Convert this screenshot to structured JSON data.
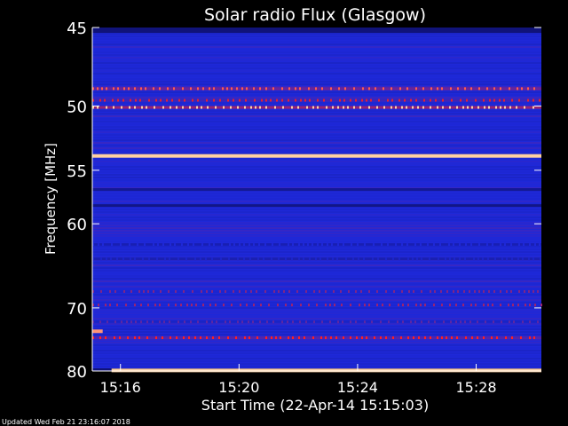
{
  "chart_data": {
    "type": "heatmap",
    "title": "Solar radio Flux (Glasgow)",
    "xlabel": "Start Time (22-Apr-14 15:15:03)",
    "ylabel": "Frequency [MHz]",
    "x_range_minutes": [
      15.05,
      30.2
    ],
    "x_ticks": [
      {
        "minute": 16,
        "label": "15:16"
      },
      {
        "minute": 20,
        "label": "15:20"
      },
      {
        "minute": 24,
        "label": "15:24"
      },
      {
        "minute": 28,
        "label": "15:28"
      }
    ],
    "y_range_mhz": [
      45,
      80
    ],
    "y_scale": "reciprocal",
    "y_ticks": [
      45,
      50,
      55,
      60,
      70,
      80
    ],
    "colormap": {
      "low": "#0a0a50",
      "mid": "#1e28d8",
      "high": "#ff2020",
      "peak": "#ffd0a0"
    },
    "bands": [
      {
        "mhz": 48.8,
        "intensity": 0.7,
        "dashed": true
      },
      {
        "mhz": 49.6,
        "intensity": 0.6,
        "dashed": true
      },
      {
        "mhz": 50.1,
        "intensity": 0.85,
        "dashed": true
      },
      {
        "mhz": 53.8,
        "intensity": 1.0,
        "dashed": false
      },
      {
        "mhz": 56.7,
        "intensity": 0.25,
        "dashed": false
      },
      {
        "mhz": 58.2,
        "intensity": 0.2,
        "dashed": false
      },
      {
        "mhz": 62.2,
        "intensity": 0.3,
        "dashed": true
      },
      {
        "mhz": 63.8,
        "intensity": 0.25,
        "dashed": true
      },
      {
        "mhz": 67.8,
        "intensity": 0.45,
        "dashed": true
      },
      {
        "mhz": 69.6,
        "intensity": 0.5,
        "dashed": true
      },
      {
        "mhz": 72.0,
        "intensity": 0.4,
        "dashed": true
      },
      {
        "mhz": 74.4,
        "intensity": 0.65,
        "dashed": true
      },
      {
        "mhz": 79.9,
        "intensity": 1.0,
        "dashed": false,
        "from_minute": 15.7
      }
    ],
    "bursts": [
      {
        "mhz": 73.4,
        "from_minute": 15.05,
        "to_minute": 15.4
      }
    ]
  },
  "footer": {
    "updated": "Updated Wed Feb 21 23:16:07 2018"
  }
}
